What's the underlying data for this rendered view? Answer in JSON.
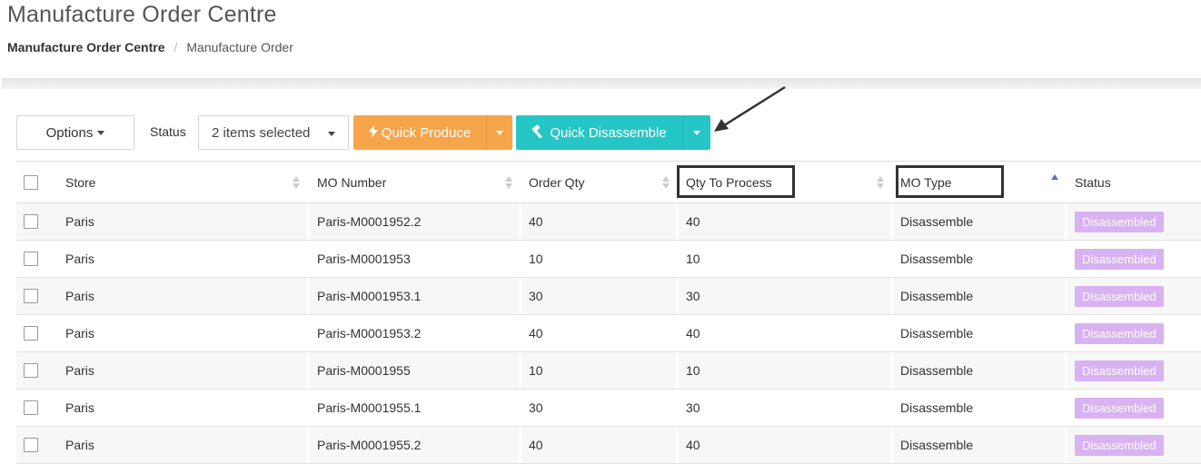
{
  "page": {
    "title": "Manufacture Order Centre",
    "breadcrumb": {
      "root": "Manufacture Order Centre",
      "separator": "/",
      "current": "Manufacture Order"
    }
  },
  "toolbar": {
    "options_label": "Options",
    "status_label": "Status",
    "status_value": "2 items selected",
    "quick_produce_label": "Quick Produce",
    "quick_produce_icon": "bolt-icon",
    "quick_disassemble_label": "Quick Disassemble",
    "quick_disassemble_icon": "hammer-icon"
  },
  "colors": {
    "produce": "#f7a54a",
    "disassemble": "#26c6c6",
    "badge": "#d8b2f2",
    "sort_active": "#5b6dd6"
  },
  "table": {
    "columns": [
      "Store",
      "MO Number",
      "Order Qty",
      "Qty To Process",
      "MO Type",
      "Status"
    ],
    "sorted_column": "MO Type",
    "sort_direction": "ascending",
    "rows": [
      {
        "store": "Paris",
        "mo_number": "Paris-M0001952.2",
        "order_qty": "40",
        "qty_to_process": "40",
        "mo_type": "Disassemble",
        "status": "Disassembled"
      },
      {
        "store": "Paris",
        "mo_number": "Paris-M0001953",
        "order_qty": "10",
        "qty_to_process": "10",
        "mo_type": "Disassemble",
        "status": "Disassembled"
      },
      {
        "store": "Paris",
        "mo_number": "Paris-M0001953.1",
        "order_qty": "30",
        "qty_to_process": "30",
        "mo_type": "Disassemble",
        "status": "Disassembled"
      },
      {
        "store": "Paris",
        "mo_number": "Paris-M0001953.2",
        "order_qty": "40",
        "qty_to_process": "40",
        "mo_type": "Disassemble",
        "status": "Disassembled"
      },
      {
        "store": "Paris",
        "mo_number": "Paris-M0001955",
        "order_qty": "10",
        "qty_to_process": "10",
        "mo_type": "Disassemble",
        "status": "Disassembled"
      },
      {
        "store": "Paris",
        "mo_number": "Paris-M0001955.1",
        "order_qty": "30",
        "qty_to_process": "30",
        "mo_type": "Disassemble",
        "status": "Disassembled"
      },
      {
        "store": "Paris",
        "mo_number": "Paris-M0001955.2",
        "order_qty": "40",
        "qty_to_process": "40",
        "mo_type": "Disassemble",
        "status": "Disassembled"
      }
    ]
  }
}
